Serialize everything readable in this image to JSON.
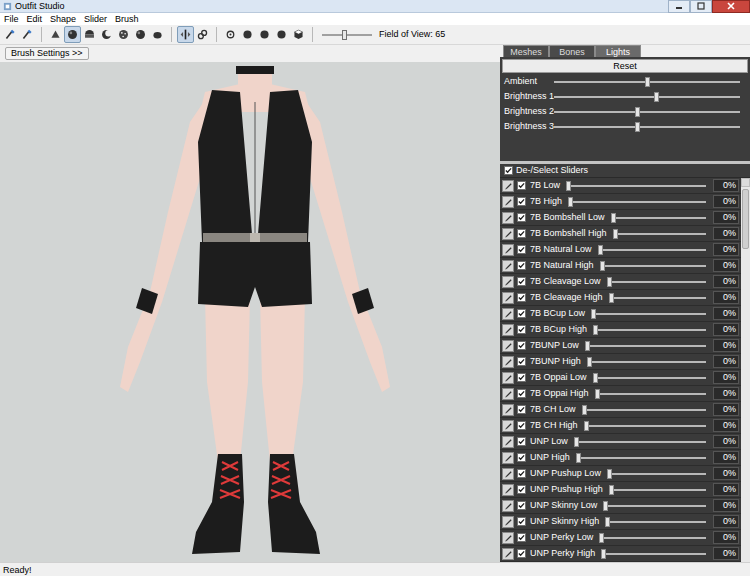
{
  "window": {
    "title": "Outfit Studio"
  },
  "menu": [
    "File",
    "Edit",
    "Shape",
    "Slider",
    "Brush"
  ],
  "toolbar": {
    "tools": [
      {
        "kind": "wand",
        "selected": false,
        "group": 1
      },
      {
        "kind": "wand",
        "selected": false,
        "group": 1
      },
      {
        "kind": "cone",
        "selected": false,
        "group": 2
      },
      {
        "kind": "sphere",
        "selected": true,
        "group": 2
      },
      {
        "kind": "half",
        "selected": false,
        "group": 2
      },
      {
        "kind": "crescent",
        "selected": false,
        "group": 2
      },
      {
        "kind": "dots",
        "selected": false,
        "group": 2
      },
      {
        "kind": "sphere",
        "selected": false,
        "group": 2
      },
      {
        "kind": "blob",
        "selected": false,
        "group": 2
      },
      {
        "kind": "mirror",
        "selected": true,
        "group": 3
      },
      {
        "kind": "link",
        "selected": false,
        "group": 3
      },
      {
        "kind": "ring",
        "selected": false,
        "group": 4
      },
      {
        "kind": "disc",
        "selected": false,
        "group": 4
      },
      {
        "kind": "disc",
        "selected": false,
        "group": 4
      },
      {
        "kind": "disc",
        "selected": false,
        "group": 4
      },
      {
        "kind": "cube",
        "selected": false,
        "group": 4
      }
    ],
    "fov": {
      "label": "Field of View: 65",
      "level": 0.45
    }
  },
  "brush_settings": "Brush Settings >>",
  "tabs": [
    {
      "label": "Meshes",
      "selected": false
    },
    {
      "label": "Bones",
      "selected": false
    },
    {
      "label": "Lights",
      "selected": true
    }
  ],
  "lights": {
    "reset": "Reset",
    "sliders": [
      {
        "label": "Ambient",
        "level": 0.5
      },
      {
        "label": "Brightness 1",
        "level": 0.55
      },
      {
        "label": "Brightness 2",
        "level": 0.45
      },
      {
        "label": "Brightness 3",
        "level": 0.45
      }
    ]
  },
  "slider_list": {
    "header": {
      "label": "De-/Select Sliders",
      "checked": true
    },
    "items": [
      {
        "name": "7B Low",
        "checked": true,
        "level": 0,
        "reading": "0%"
      },
      {
        "name": "7B High",
        "checked": true,
        "level": 0,
        "reading": "0%"
      },
      {
        "name": "7B Bombshell Low",
        "checked": true,
        "level": 0,
        "reading": "0%"
      },
      {
        "name": "7B Bombshell High",
        "checked": true,
        "level": 0,
        "reading": "0%"
      },
      {
        "name": "7B Natural Low",
        "checked": true,
        "level": 0,
        "reading": "0%"
      },
      {
        "name": "7B Natural High",
        "checked": true,
        "level": 0,
        "reading": "0%"
      },
      {
        "name": "7B Cleavage Low",
        "checked": true,
        "level": 0,
        "reading": "0%"
      },
      {
        "name": "7B Cleavage High",
        "checked": true,
        "level": 0,
        "reading": "0%"
      },
      {
        "name": "7B BCup Low",
        "checked": true,
        "level": 0,
        "reading": "0%"
      },
      {
        "name": "7B BCup High",
        "checked": true,
        "level": 0,
        "reading": "0%"
      },
      {
        "name": "7BUNP Low",
        "checked": true,
        "level": 0,
        "reading": "0%"
      },
      {
        "name": "7BUNP High",
        "checked": true,
        "level": 0,
        "reading": "0%"
      },
      {
        "name": "7B Oppai Low",
        "checked": true,
        "level": 0,
        "reading": "0%"
      },
      {
        "name": "7B Oppai High",
        "checked": true,
        "level": 0,
        "reading": "0%"
      },
      {
        "name": "7B CH Low",
        "checked": true,
        "level": 0,
        "reading": "0%"
      },
      {
        "name": "7B CH High",
        "checked": true,
        "level": 0,
        "reading": "0%"
      },
      {
        "name": "UNP Low",
        "checked": true,
        "level": 0,
        "reading": "0%"
      },
      {
        "name": "UNP High",
        "checked": true,
        "level": 0,
        "reading": "0%"
      },
      {
        "name": "UNP Pushup Low",
        "checked": true,
        "level": 0,
        "reading": "0%"
      },
      {
        "name": "UNP Pushup High",
        "checked": true,
        "level": 0,
        "reading": "0%"
      },
      {
        "name": "UNP Skinny Low",
        "checked": true,
        "level": 0,
        "reading": "0%"
      },
      {
        "name": "UNP Skinny High",
        "checked": true,
        "level": 0,
        "reading": "0%"
      },
      {
        "name": "UNP Perky Low",
        "checked": true,
        "level": 0,
        "reading": "0%"
      },
      {
        "name": "UNP Perky High",
        "checked": true,
        "level": 0,
        "reading": "0%"
      }
    ]
  },
  "status_bar": "Ready!"
}
